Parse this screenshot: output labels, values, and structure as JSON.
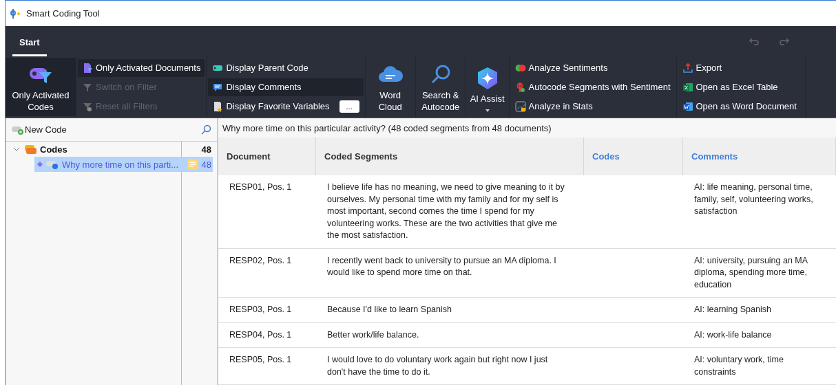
{
  "window": {
    "title": "Smart Coding Tool"
  },
  "tabs": [
    {
      "label": "Start",
      "selected": true
    }
  ],
  "ribbon": {
    "groups": [
      {
        "items": [
          {
            "kind": "large",
            "label": "Only Activated Codes",
            "active": true,
            "disabled": false
          }
        ]
      },
      {
        "items": [
          {
            "kind": "small",
            "label": "Only Activated Documents",
            "active": true,
            "disabled": false
          },
          {
            "kind": "small",
            "label": "Switch on Filter",
            "active": false,
            "disabled": true
          },
          {
            "kind": "small",
            "label": "Reset all Filters",
            "active": false,
            "disabled": true
          }
        ]
      },
      {
        "items": [
          {
            "kind": "small",
            "label": "Display Parent Code",
            "active": false,
            "disabled": false
          },
          {
            "kind": "small",
            "label": "Display Comments",
            "active": true,
            "disabled": false
          },
          {
            "kind": "small",
            "label": "Display Favorite Variables",
            "active": false,
            "disabled": false,
            "extra": "..."
          }
        ]
      },
      {
        "items": [
          {
            "kind": "large",
            "label": "Word Cloud",
            "active": false,
            "disabled": false
          }
        ]
      },
      {
        "items": [
          {
            "kind": "large",
            "label": "Search & Autocode",
            "active": false,
            "disabled": false
          }
        ]
      },
      {
        "items": [
          {
            "kind": "large",
            "label": "AI Assist",
            "active": false,
            "disabled": false,
            "dropdown": true
          }
        ]
      },
      {
        "items": [
          {
            "kind": "small",
            "label": "Analyze Sentiments",
            "active": false,
            "disabled": false
          },
          {
            "kind": "small",
            "label": "Autocode Segments with Sentiment",
            "active": false,
            "disabled": false
          },
          {
            "kind": "small",
            "label": "Analyze in Stats",
            "active": false,
            "disabled": false
          }
        ]
      },
      {
        "items": [
          {
            "kind": "small",
            "label": "Export",
            "active": false,
            "disabled": false
          },
          {
            "kind": "small",
            "label": "Open as Excel Table",
            "active": false,
            "disabled": false
          },
          {
            "kind": "small",
            "label": "Open as Word Document",
            "active": false,
            "disabled": false
          }
        ]
      }
    ]
  },
  "code_panel": {
    "new_code": "New Code",
    "tree": [
      {
        "label": "Codes",
        "count": "48",
        "expanded": true,
        "selected": false,
        "children": [
          {
            "label": "Why more time on this parti...",
            "count": "48",
            "selected": true
          }
        ]
      }
    ]
  },
  "results": {
    "heading": "Why more time on this particular activity? (48 coded segments from 48 documents)",
    "columns": [
      "Document",
      "Coded Segments",
      "Codes",
      "Comments"
    ],
    "rows": [
      {
        "document": "RESP01, Pos. 1",
        "segment": "I believe life has no meaning, we need to give meaning to it by ourselves. My personal time with my family and for my self is most important, second comes the time I spend for my volunteering works. These are the two activities that give me the most satisfaction.",
        "comment": "AI: life meaning, personal time, family, self, volunteering works, satisfaction"
      },
      {
        "document": "RESP02, Pos. 1",
        "segment": "I recently went back to university to pursue an MA diploma. I would like to spend more time on that.",
        "comment": "AI: university, pursuing an MA diploma, spending more time, education"
      },
      {
        "document": "RESP03, Pos. 1",
        "segment": "Because I'd like to learn Spanish",
        "comment": "AI: learning Spanish"
      },
      {
        "document": "RESP04, Pos. 1",
        "segment": "Better work/life balance.",
        "comment": "AI: work-life balance"
      },
      {
        "document": "RESP05, Pos. 1",
        "segment": "I would love to do voluntary work again but right now I just don't have the time to do it.",
        "comment": "AI: voluntary work, time constraints"
      }
    ]
  }
}
